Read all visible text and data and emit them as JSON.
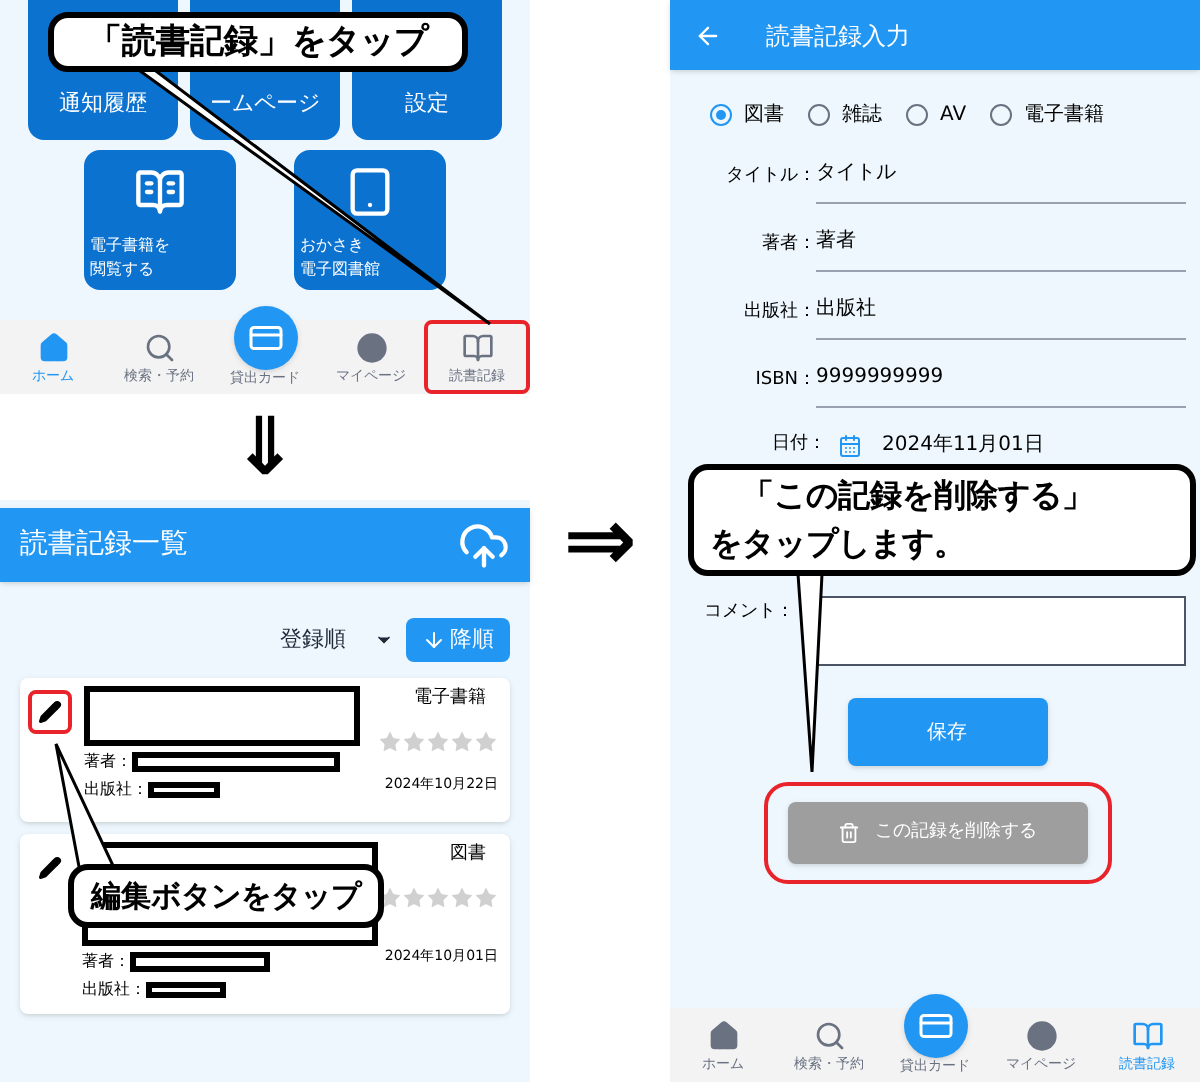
{
  "home_screen": {
    "tiles": [
      {
        "lines": [
          "通知履歴"
        ]
      },
      {
        "lines": [
          "ームページ"
        ]
      },
      {
        "lines": [
          "設定"
        ]
      },
      {
        "kind": "book",
        "lines": [
          "電子書籍を",
          "閲覧する"
        ]
      },
      {
        "kind": "tablet",
        "lines": [
          "おかさき",
          "電子図書館"
        ]
      }
    ],
    "bottom_nav": [
      {
        "kind": "home",
        "label": "ホーム",
        "selected": true,
        "highlighted": false
      },
      {
        "kind": "search",
        "label": "検索・予約",
        "selected": false,
        "highlighted": false
      },
      {
        "kind": "card",
        "label": "貸出カード",
        "selected": false,
        "highlighted": false
      },
      {
        "kind": "user",
        "label": "マイページ",
        "selected": false,
        "highlighted": false
      },
      {
        "kind": "book",
        "label": "読書記録",
        "selected": false,
        "highlighted": true
      }
    ]
  },
  "down_arrow": "⇓",
  "right_arrow": "⇒",
  "list_screen": {
    "title": "読書記録一覧",
    "sort": "登録順",
    "order_button": "降順",
    "cards": [
      {
        "type": "電子書籍",
        "date": "2024年10月22日",
        "stars": 0,
        "author_label": "著者：",
        "publisher_label": "出版社：",
        "highlighted": true
      },
      {
        "type": "図書",
        "date": "2024年10月01日",
        "stars": 0,
        "author_label": "著者：",
        "publisher_label": "出版社：",
        "highlighted": false
      }
    ]
  },
  "form_screen": {
    "title": "読書記録入力",
    "radios": [
      {
        "label": "図書",
        "selected": true
      },
      {
        "label": "雑誌",
        "selected": false
      },
      {
        "label": "AV",
        "selected": false
      },
      {
        "label": "電子書籍",
        "selected": false
      }
    ],
    "fields": [
      {
        "label": "タイトル：",
        "value": "タイトル"
      },
      {
        "label": "著者：",
        "value": "著者"
      },
      {
        "label": "出版社：",
        "value": "出版社"
      },
      {
        "label": "ISBN：",
        "value": "9999999999"
      }
    ],
    "date": {
      "label": "日付：",
      "value": "2024年11月01日"
    },
    "comment_label": "コメント：",
    "save_button": "保存",
    "delete_button": {
      "label": "この記録を削除する",
      "highlighted": true
    },
    "bottom_nav": [
      {
        "kind": "home",
        "label": "ホーム",
        "selected": false,
        "highlighted": false
      },
      {
        "kind": "search",
        "label": "検索・予約",
        "selected": false,
        "highlighted": false
      },
      {
        "kind": "card",
        "label": "貸出カード",
        "selected": false,
        "highlighted": false
      },
      {
        "kind": "user",
        "label": "マイページ",
        "selected": false,
        "highlighted": false
      },
      {
        "kind": "book",
        "label": "読書記録",
        "selected": true,
        "highlighted": false
      }
    ]
  },
  "callouts": [
    {
      "lines": [
        "「読書記録」をタップ"
      ]
    },
    {
      "lines": [
        "編集ボタンをタップ"
      ]
    },
    {
      "lines": [
        "　「この記録を削除する」",
        "をタップします。"
      ]
    }
  ]
}
